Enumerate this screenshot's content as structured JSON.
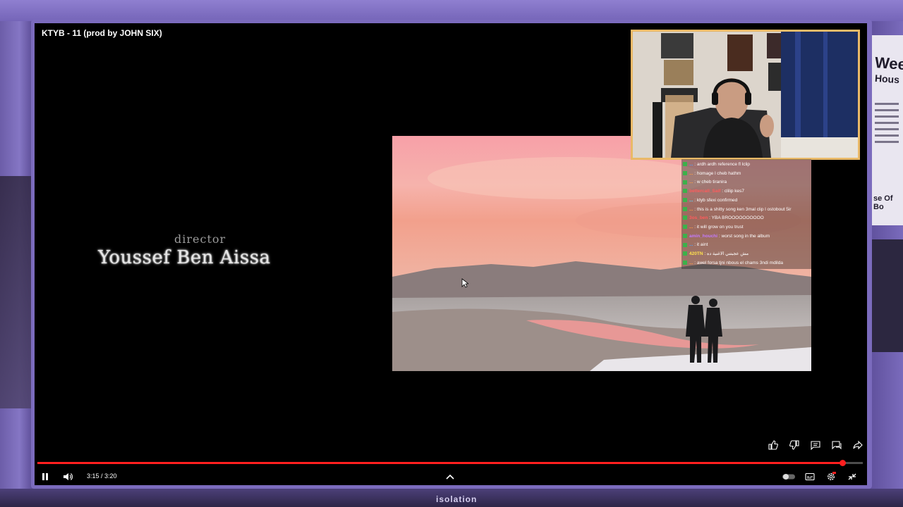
{
  "video": {
    "title": "KTYB  - 11 (prod by JOHN SIX)",
    "credit_role": "director",
    "credit_name": "Youssef Ben Aissa",
    "time_display": "3:15 / 3:20",
    "progress": 0.975
  },
  "chat": [
    {
      "user": "...",
      "message": ": ardh ardh reference fl lclip",
      "color": "#4fa3ff"
    },
    {
      "user": "...",
      "message": ": homage l cheb hathm",
      "color": "#ff9f43"
    },
    {
      "user": "...",
      "message": ": w cheb tiranira",
      "color": "#ff9f43"
    },
    {
      "user": "bettercall_Saif",
      "message": ": clilip kes7",
      "color": "#ff5b5b"
    },
    {
      "user": "...",
      "message": ": ktyb sfexi confirmed",
      "color": "#57d7ff"
    },
    {
      "user": "...",
      "message": ": this is a shitty song ken 3mal clip l ostobout 5ir",
      "color": "#ff9f43"
    },
    {
      "user": "3os_ben",
      "message": ": YBA BROOOOOOOOOO",
      "color": "#ff5b5b"
    },
    {
      "user": "...",
      "message": ": it will grow on you trust",
      "color": "#ff9f43"
    },
    {
      "user": "amin_houchi",
      "message": ": worst song in the album",
      "color": "#c37bff"
    },
    {
      "user": "...",
      "message": ": it aint",
      "color": "#4fa3ff"
    },
    {
      "user": "420TN",
      "message": ": مش عجبتني الاغنية ده",
      "color": "#ffe14d"
    },
    {
      "user": "...",
      "message": ": awel forsa tjni nbous el chams 3ndi mdilda",
      "color": "#ff9f43"
    }
  ],
  "overlay": {
    "brand": "isolation",
    "poster_head": "Week",
    "poster_sub": "Hous",
    "poster_title": "se Of Bo"
  },
  "controls": {
    "like_icon": "thumbs-up-icon",
    "dislike_icon": "thumbs-down-icon",
    "comment_icon": "comment-icon",
    "chat_icon": "chat-icon",
    "share_icon": "share-icon",
    "pause_icon": "pause-icon",
    "volume_icon": "volume-icon",
    "expand_icon": "chevron-up-icon",
    "autoplay_icon": "autoplay-toggle-icon",
    "subtitles_icon": "subtitles-icon",
    "settings_icon": "gear-icon",
    "exit_fullscreen_icon": "exit-fullscreen-icon"
  },
  "colors": {
    "progress": "#ff1f1f",
    "webcam_border": "#e9b968",
    "overlay_purple": "#7b6bbd"
  }
}
